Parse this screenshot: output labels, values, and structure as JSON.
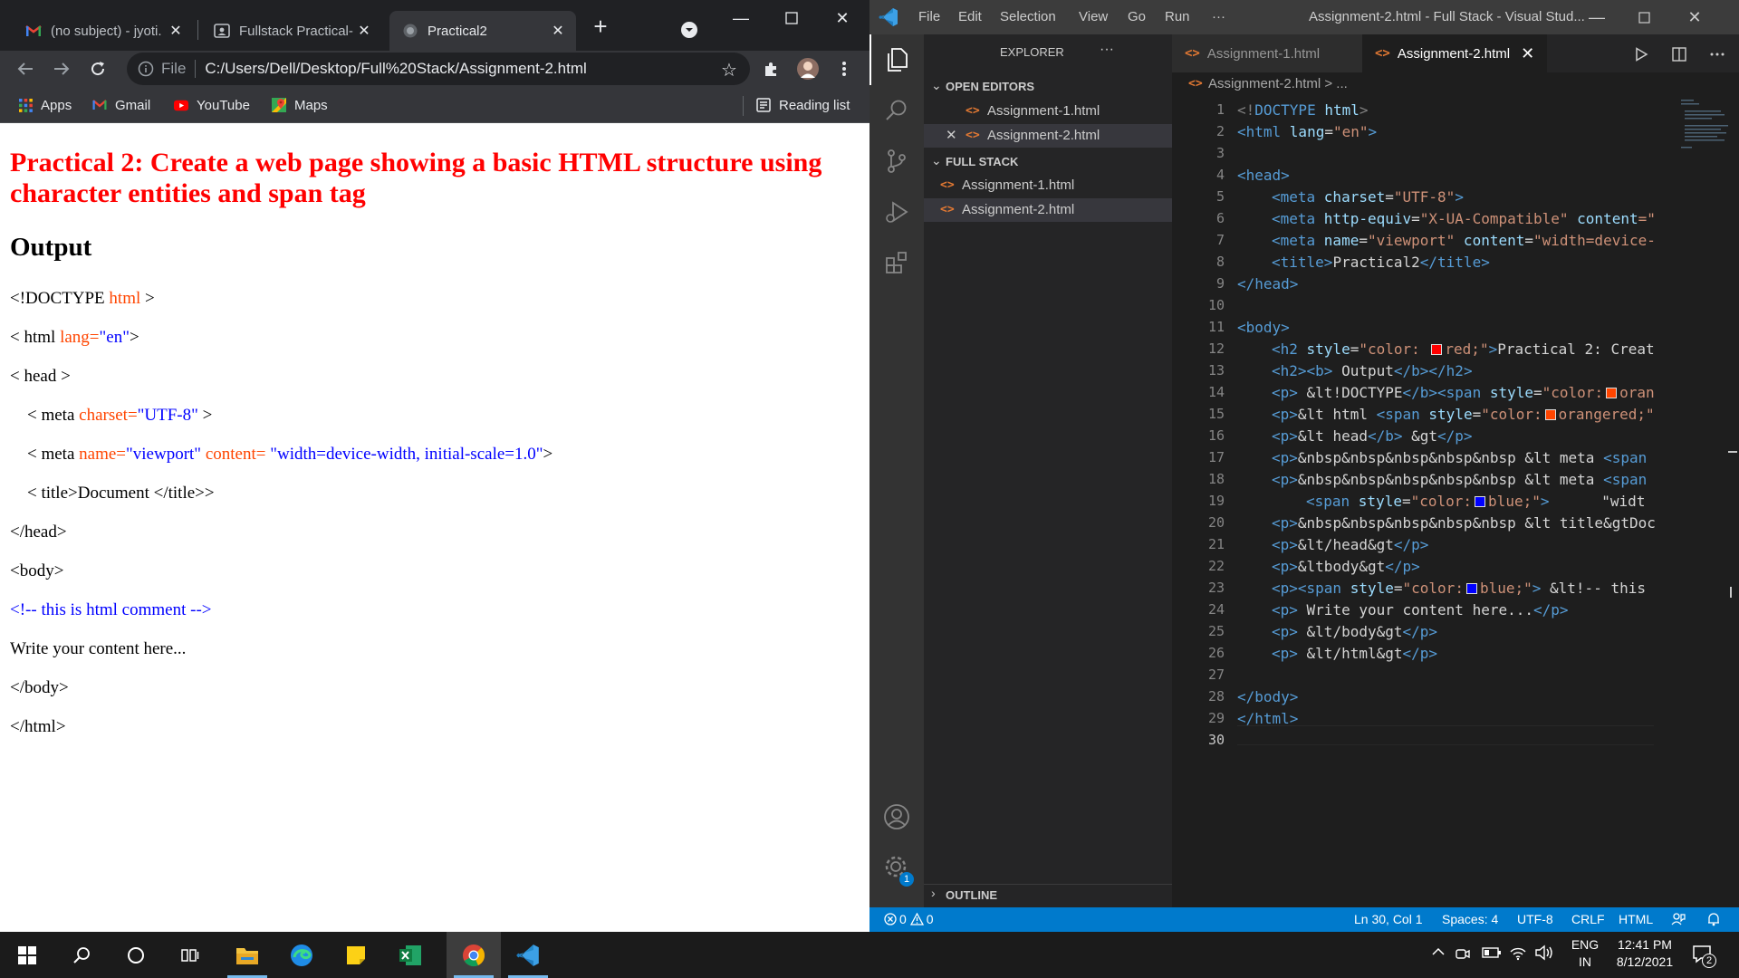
{
  "chrome": {
    "tabs": [
      {
        "title": "(no subject) - jyoti.",
        "icon": "gmail-icon"
      },
      {
        "title": "Fullstack Practical-",
        "icon": "classroom-icon"
      },
      {
        "title": "Practical2",
        "icon": "globe-icon"
      }
    ],
    "omnibox": {
      "scheme_label": "File",
      "url": "C:/Users/Dell/Desktop/Full%20Stack/Assignment-2.html"
    },
    "bookmarks": [
      {
        "label": "Apps",
        "icon": "apps-grid-icon"
      },
      {
        "label": "Gmail",
        "icon": "gmail-icon"
      },
      {
        "label": "YouTube",
        "icon": "youtube-icon"
      },
      {
        "label": "Maps",
        "icon": "maps-icon"
      }
    ],
    "reading_list": "Reading list",
    "page": {
      "heading": "Practical 2: Create a web page showing a basic HTML structure using character entities and span tag",
      "output": "Output",
      "l1_a": "<!DOCTYPE ",
      "l1_b": "html",
      "l1_c": " >",
      "l2_a": "< html ",
      "l2_b": "lang=",
      "l2_c": "\"en\"",
      "l2_d": ">",
      "l3": "< head >",
      "l4_a": "    < meta ",
      "l4_b": "charset=",
      "l4_c": "\"UTF-8\"",
      "l4_d": " >",
      "l5_a": "    < meta ",
      "l5_b": "name=",
      "l5_c": "\"viewport\"",
      "l5_d": " content= ",
      "l5_e": "\"width=device-width, initial-scale=1.0\"",
      "l5_f": ">",
      "l6": "    < title>Document </title>>",
      "l7": "</head>",
      "l8": "<body>",
      "l9": "<!-- this is html comment -->",
      "l10": "Write your content here...",
      "l11": "</body>",
      "l12": "</html>"
    }
  },
  "vscode": {
    "menu": [
      "File",
      "Edit",
      "Selection",
      "View",
      "Go",
      "Run",
      "···"
    ],
    "window_title": "Assignment-2.html - Full Stack - Visual Stud...",
    "sidebar": {
      "title": "EXPLORER",
      "more": "···",
      "open_editors_label": "OPEN EDITORS",
      "open_editors": [
        "Assignment-1.html",
        "Assignment-2.html"
      ],
      "folder_label": "FULL STACK",
      "folder_files": [
        "Assignment-1.html",
        "Assignment-2.html"
      ],
      "outline_label": "OUTLINE"
    },
    "tabs": [
      "Assignment-1.html",
      "Assignment-2.html"
    ],
    "breadcrumb": "Assignment-2.html > ...",
    "code": {
      "l1": "<!DOCTYPE html>",
      "l2_a": "<html ",
      "l2_b": "lang",
      "l2_c": "=",
      "l2_d": "\"en\"",
      "l2_e": ">",
      "l4": "<head>",
      "l5_a": "<meta ",
      "l5_b": "charset",
      "l5_c": "=",
      "l5_d": "\"UTF-8\"",
      "l5_e": ">",
      "l6_a": "<meta ",
      "l6_b": "http-equiv",
      "l6_c": "=",
      "l6_d": "\"X-UA-Compatible\"",
      "l6_e": " content",
      "l6_f": "=\"",
      "l7_a": "<meta ",
      "l7_b": "name",
      "l7_c": "=",
      "l7_d": "\"viewport\"",
      "l7_e": " content",
      "l7_f": "=",
      "l7_g": "\"width=device-",
      "l8_a": "<title>",
      "l8_b": "Practical2",
      "l8_c": "</title>",
      "l9": "</head>",
      "l11": "<body>",
      "l12_a": "<h2 ",
      "l12_b": "style",
      "l12_c": "=",
      "l12_d": "\"color: ",
      "l12_e": "red;\"",
      "l12_f": ">",
      "l12_g": "Practical 2: Creat",
      "l13_a": "<h2><b>",
      "l13_b": " Output",
      "l13_c": "</b></h2>",
      "l14_a": "<p>",
      "l14_b": " &lt!DOCTYPE",
      "l14_c": "</b><span ",
      "l14_d": "style",
      "l14_e": "=",
      "l14_f": "\"color:",
      "l14_g": "oran",
      "l15_a": "<p>",
      "l15_b": "&lt html ",
      "l15_c": "<span ",
      "l15_d": "style",
      "l15_e": "=",
      "l15_f": "\"color:",
      "l15_g": "orangered;\"",
      "l16_a": "<p>",
      "l16_b": "&lt head",
      "l16_c": "</b>",
      "l16_d": " &gt",
      "l16_e": "</p>",
      "l17_a": "<p>",
      "l17_b": "&nbsp&nbsp&nbsp&nbsp&nbsp &lt meta ",
      "l17_c": "<span",
      "l18_a": "<p>",
      "l18_b": "&nbsp&nbsp&nbsp&nbsp&nbsp &lt meta ",
      "l18_c": "<span",
      "l19_a": "<span ",
      "l19_b": "style",
      "l19_c": "=",
      "l19_d": "\"color:",
      "l19_e": "blue;\"",
      "l19_f": ">",
      "l19_g": "      \"widt",
      "l20_a": "<p>",
      "l20_b": "&nbsp&nbsp&nbsp&nbsp&nbsp &lt title&gtDoc",
      "l21_a": "<p>",
      "l21_b": "&lt/head&gt",
      "l21_c": "</p>",
      "l22_a": "<p>",
      "l22_b": "&ltbody&gt",
      "l22_c": "</p>",
      "l23_a": "<p><span ",
      "l23_b": "style",
      "l23_c": "=",
      "l23_d": "\"color:",
      "l23_e": "blue;\"",
      "l23_f": ">",
      "l23_g": " &lt!-- this",
      "l24_a": "<p>",
      "l24_b": " Write your content here...",
      "l24_c": "</p>",
      "l25_a": "<p>",
      "l25_b": " &lt/body&gt",
      "l25_c": "</p>",
      "l26_a": "<p>",
      "l26_b": " &lt/html&gt",
      "l26_c": "</p>",
      "l28": "</body>",
      "l29": "</html>"
    },
    "swatch_colors": {
      "red": "#ff0000",
      "orange": "#ff4500",
      "blue": "#0000ff"
    },
    "status": {
      "errors": "0",
      "warnings": "0",
      "position": "Ln 30, Col 1",
      "spaces": "Spaces: 4",
      "encoding": "UTF-8",
      "eol": "CRLF",
      "language": "HTML"
    },
    "settings_badge": "1"
  },
  "taskbar": {
    "language_top": "ENG",
    "language_bottom": "IN",
    "time": "12:41 PM",
    "date": "8/12/2021",
    "notifications": "2"
  }
}
